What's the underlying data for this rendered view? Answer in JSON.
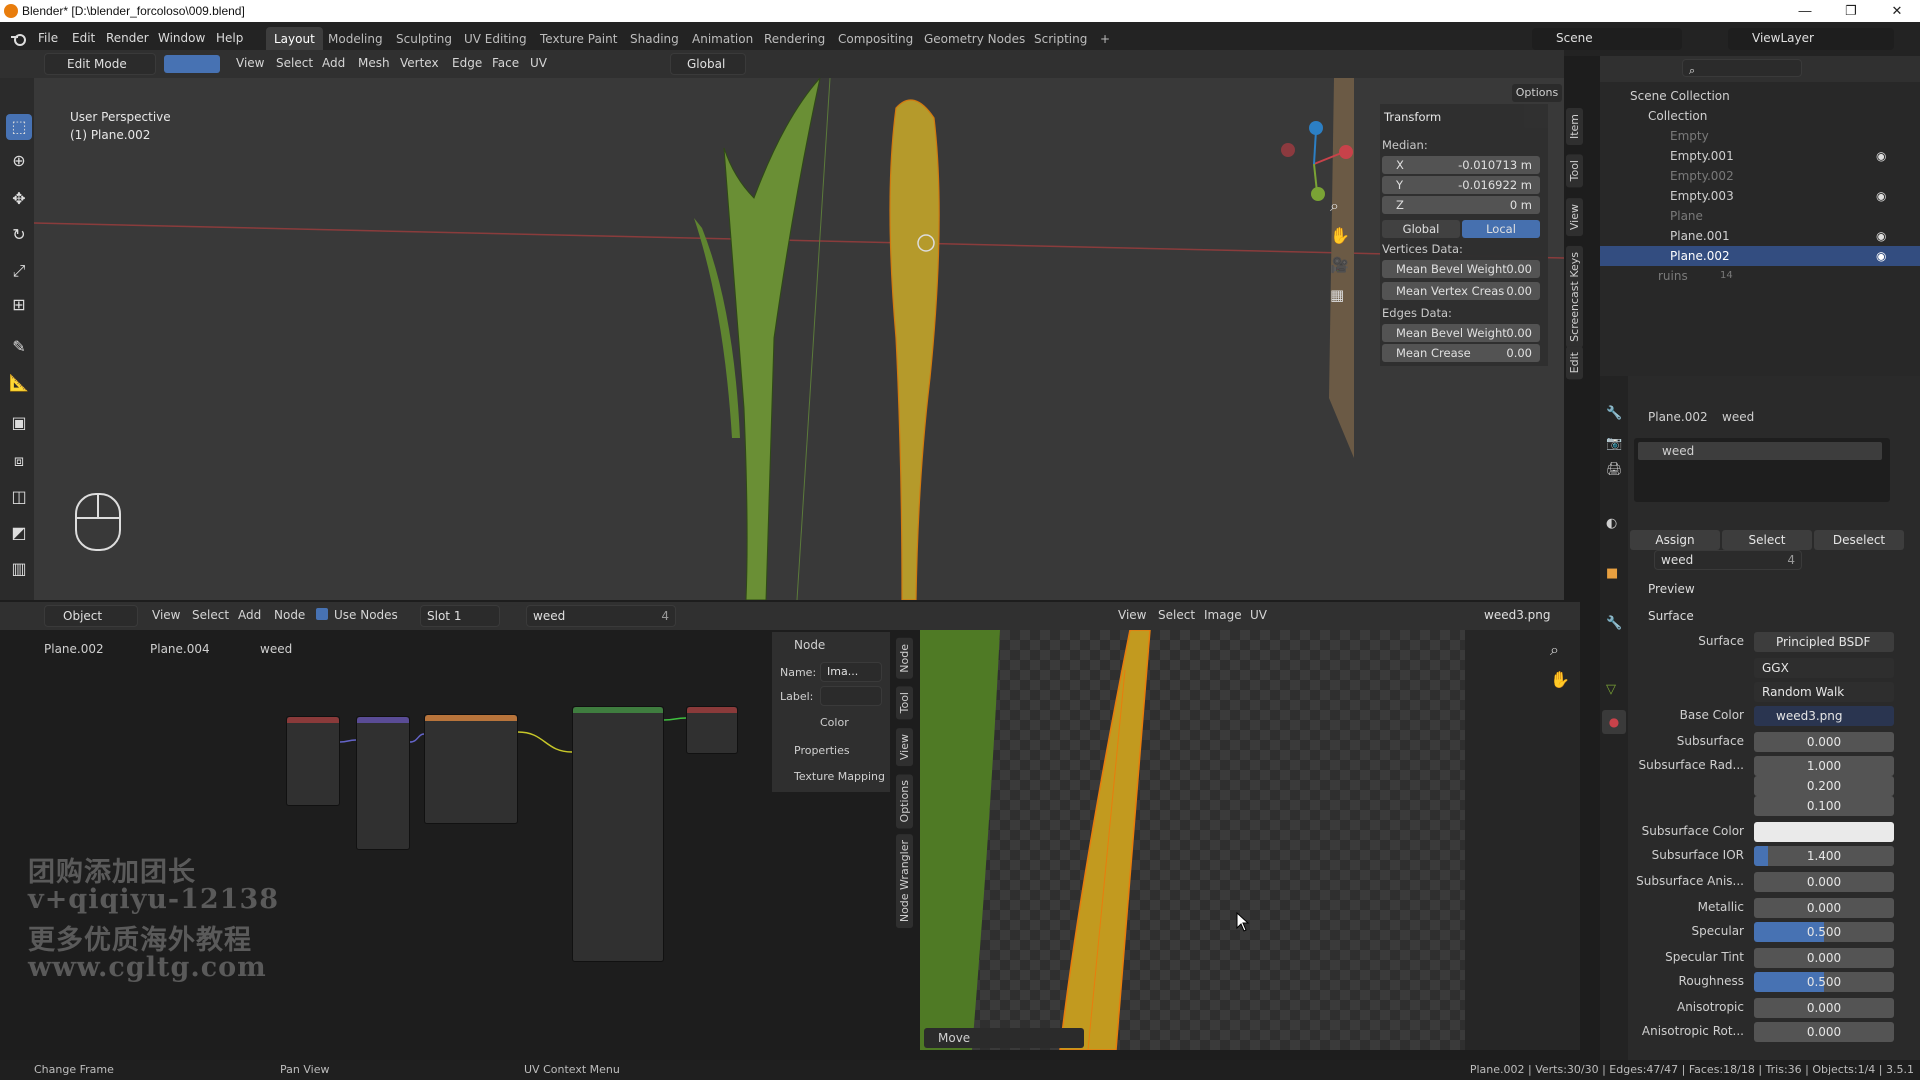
{
  "window": {
    "title": "Blender* [D:\\blender_forcoloso\\009.blend]",
    "controls": [
      "—",
      "❐",
      "✕"
    ]
  },
  "menus": [
    "File",
    "Edit",
    "Render",
    "Window",
    "Help"
  ],
  "workspaces": [
    "Layout",
    "Modeling",
    "Sculpting",
    "UV Editing",
    "Texture Paint",
    "Shading",
    "Animation",
    "Rendering",
    "Compositing",
    "Geometry Nodes",
    "Scripting",
    "+"
  ],
  "scene": {
    "label": "Scene",
    "view_layer": "ViewLayer"
  },
  "viewport_header": {
    "mode": "Edit Mode",
    "items": [
      "View",
      "Select",
      "Add",
      "Mesh",
      "Vertex",
      "Edge",
      "Face",
      "UV"
    ],
    "orientation": "Global",
    "options": "Options",
    "axes": [
      "X",
      "Y",
      "Z"
    ]
  },
  "viewport": {
    "perspective": "User Perspective",
    "object": "(1) Plane.002"
  },
  "npanel": {
    "transform_title": "Transform",
    "median": "Median:",
    "x_label": "X",
    "x_value": "-0.010713 m",
    "y_label": "Y",
    "y_value": "-0.016922 m",
    "z_label": "Z",
    "z_value": "0 m",
    "global": "Global",
    "local": "Local",
    "vertices_data": "Vertices Data:",
    "mean_bevel_weight_label": "Mean Bevel Weight",
    "mean_bevel_weight": "0.00",
    "mean_vertex_crease_label": "Mean Vertex Creas",
    "mean_vertex_crease": "0.00",
    "edges_data": "Edges Data:",
    "edge_bevel_weight_label": "Mean Bevel Weight",
    "edge_bevel_weight": "0.00",
    "mean_crease_label": "Mean Crease",
    "mean_crease": "0.00",
    "tabs": [
      "Item",
      "Tool",
      "View",
      "Screencast Keys",
      "Edit"
    ]
  },
  "outliner": {
    "root": "Scene Collection",
    "collection": "Collection",
    "items": [
      {
        "name": "Empty",
        "dim": true
      },
      {
        "name": "Empty.001",
        "dim": false
      },
      {
        "name": "Empty.002",
        "dim": true
      },
      {
        "name": "Empty.003",
        "dim": false
      },
      {
        "name": "Plane",
        "dim": true
      },
      {
        "name": "Plane.001",
        "dim": false
      },
      {
        "name": "Plane.002",
        "dim": false,
        "selected": true
      }
    ],
    "ruins": "ruins",
    "ruins_count": "14"
  },
  "properties": {
    "breadcrumb_object": "Plane.002",
    "breadcrumb_material": "weed",
    "slot_name": "weed",
    "assign": "Assign",
    "select": "Select",
    "deselect": "Deselect",
    "material": "weed",
    "users": "4",
    "preview": "Preview",
    "surface_section": "Surface",
    "surface_label": "Surface",
    "surface_value": "Principled BSDF",
    "distribution": "GGX",
    "subsurface_method": "Random Walk",
    "base_color_label": "Base Color",
    "base_color_value": "weed3.png",
    "subsurface_label": "Subsurface",
    "subsurface": "0.000",
    "subsurface_radius_label": "Subsurface Rad...",
    "subsurface_radius": [
      "1.000",
      "0.200",
      "0.100"
    ],
    "subsurface_color_label": "Subsurface Color",
    "subsurface_ior_label": "Subsurface IOR",
    "subsurface_ior": "1.400",
    "subsurface_anis_label": "Subsurface Anis...",
    "subsurface_anis": "0.000",
    "metallic_label": "Metallic",
    "metallic": "0.000",
    "specular_label": "Specular",
    "specular": "0.500",
    "specular_tint_label": "Specular Tint",
    "specular_tint": "0.000",
    "roughness_label": "Roughness",
    "roughness": "0.500",
    "anisotropic_label": "Anisotropic",
    "anisotropic": "0.000",
    "anisotropic_rot_label": "Anisotropic Rot...",
    "anisotropic_rot": "0.000"
  },
  "node_editor": {
    "mode": "Object",
    "items": [
      "View",
      "Select",
      "Add",
      "Node"
    ],
    "use_nodes": "Use Nodes",
    "slot": "Slot 1",
    "material": "weed",
    "users": "4",
    "breadcrumb": [
      "Plane.002",
      "Plane.004",
      "weed"
    ],
    "side_tabs": [
      "Node",
      "Tool",
      "View",
      "Options",
      "Node Wrangler"
    ],
    "panel": {
      "node": "Node",
      "name_label": "Name:",
      "name_value": "Ima...",
      "label_label": "Label:",
      "color": "Color",
      "properties": "Properties",
      "texture_mapping": "Texture Mapping"
    }
  },
  "image_editor": {
    "items": [
      "View",
      "Select",
      "Image",
      "UV"
    ],
    "image": "weed3.png",
    "last_op": "Move"
  },
  "watermark": [
    "团购添加团长",
    "v+qiqiyu-12138",
    "更多优质海外教程",
    "www.cgltg.com"
  ],
  "status": {
    "left": "Change Frame",
    "mid": "Pan View",
    "right": "UV Context Menu",
    "stats": "Plane.002 | Verts:30/30 | Edges:47/47 | Faces:18/18 | Tris:36 | Objects:1/4 | 3.5.1"
  },
  "colors": {
    "accent": "#4772b3",
    "selected_row": "#334d80",
    "x_axis": "#c8424a",
    "y_axis": "#7aa335",
    "z_axis": "#2c7fc4",
    "edit_orange": "#e87d0d"
  }
}
